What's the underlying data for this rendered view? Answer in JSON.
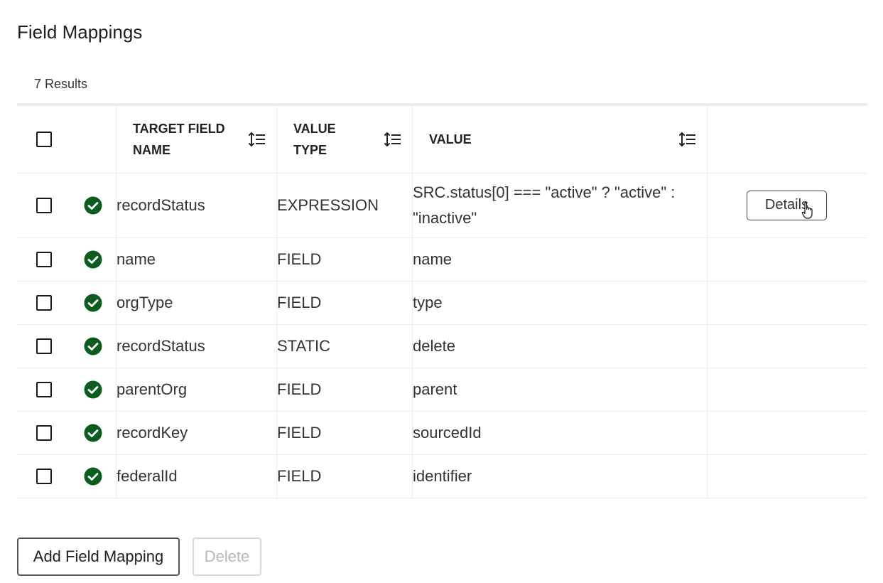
{
  "page": {
    "title": "Field Mappings",
    "result_count": "7 Results"
  },
  "table": {
    "headers": {
      "target_field_name": "TARGET FIELD NAME",
      "value_type": "VALUE TYPE",
      "value": "VALUE"
    },
    "rows": [
      {
        "target": "recordStatus",
        "type": "EXPRESSION",
        "value": "SRC.status[0] === \"active\" ? \"active\" : \"inactive\"",
        "action": "Details"
      },
      {
        "target": "name",
        "type": "FIELD",
        "value": "name"
      },
      {
        "target": "orgType",
        "type": "FIELD",
        "value": "type"
      },
      {
        "target": "recordStatus",
        "type": "STATIC",
        "value": "delete"
      },
      {
        "target": "parentOrg",
        "type": "FIELD",
        "value": "parent"
      },
      {
        "target": "recordKey",
        "type": "FIELD",
        "value": "sourcedId"
      },
      {
        "target": "federalId",
        "type": "FIELD",
        "value": "identifier"
      }
    ]
  },
  "actions": {
    "add_label": "Add Field Mapping",
    "delete_label": "Delete"
  },
  "icons": {
    "row_status": "check-circle-icon",
    "sort": "sort-icon",
    "cursor": "hand-pointer-icon"
  },
  "colors": {
    "status_ok": "#0a5c1f",
    "details_border": "#2e4a5a",
    "disabled_text": "#b8b8b8"
  }
}
